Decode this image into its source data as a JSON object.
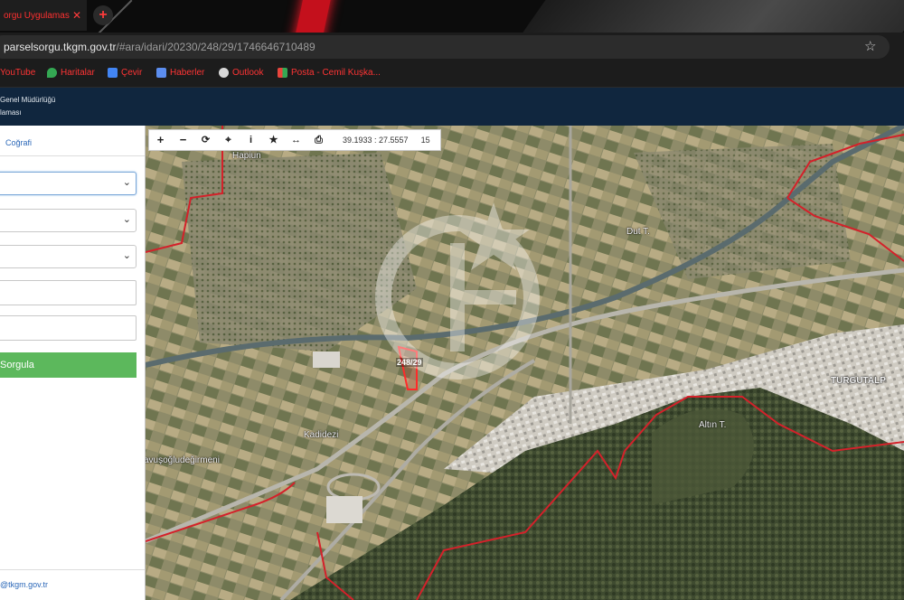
{
  "browser": {
    "tab_title": "orgu Uygulamas",
    "url_host": "parselsorgu.tkgm.gov.tr",
    "url_path": "/#ara/idari/20230/248/29/1746646710489",
    "bookmarks": [
      {
        "label": "YouTube",
        "icon": "youtube-icon",
        "color": "#ff0000"
      },
      {
        "label": "Haritalar",
        "icon": "maps-pin-icon",
        "color": "#34a853"
      },
      {
        "label": "Çevir",
        "icon": "translate-icon",
        "color": "#4285f4"
      },
      {
        "label": "Haberler",
        "icon": "news-icon",
        "color": "#5b8def"
      },
      {
        "label": "Outlook",
        "icon": "globe-icon",
        "color": "#d8d8d8"
      },
      {
        "label": "Posta - Cemil Kuşka...",
        "icon": "office-icon",
        "color": "#e8453c"
      }
    ]
  },
  "app": {
    "header_line1": "Genel Müdürlüğü",
    "header_line2": "laması",
    "panel_tab": "Coğrafi",
    "query_button": "Sorgula",
    "footer_link": "@tkgm.gov.tr"
  },
  "map": {
    "coords": "39.1933 : 27.5557",
    "zoom_level": "15",
    "parcel_label": "248/29",
    "place_labels": {
      "top_left": "Hapiun",
      "kadidezi": "Kadidezi",
      "avusoglu": "avuşoğludeğirmeni",
      "turgutalp": "TURGUTALP",
      "altin": "Altın T.",
      "dut": "Dut T."
    },
    "colors": {
      "boundary": "#d4212a",
      "parcel": "#ff2a2a",
      "farmland": "#8c8a6a",
      "urban": "#c7c4bb",
      "forest": "#3c4a2e"
    }
  }
}
